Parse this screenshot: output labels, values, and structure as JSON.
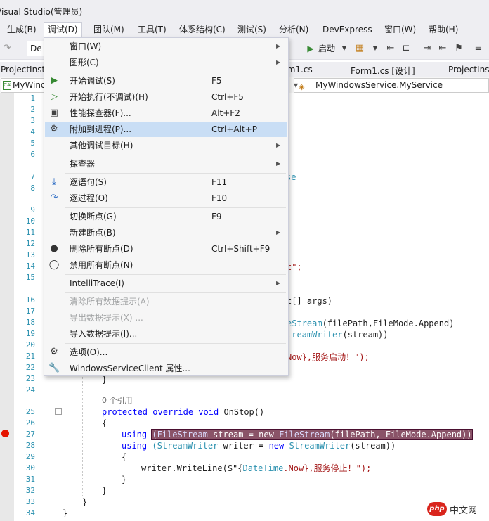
{
  "window": {
    "title": "Visual Studio(管理员)"
  },
  "menubar": {
    "items": [
      "生成(B)",
      "调试(D)",
      "团队(M)",
      "工具(T)",
      "体系结构(C)",
      "测试(S)",
      "分析(N)",
      "DevExpress",
      "窗口(W)",
      "帮助(H)"
    ],
    "active": "调试(D)"
  },
  "toolbar": {
    "config_combo": "De",
    "start_label": "启动"
  },
  "tabs": [
    "ProjectInst",
    "rm1.cs",
    "Form1.cs [设计]",
    "ProjectInst"
  ],
  "navbar": {
    "left": "MyWind",
    "right": "MyWindowsService.MyService"
  },
  "debug_menu": {
    "items": [
      {
        "icon": "",
        "label": "窗口(W)",
        "shortcut": "",
        "submenu": true
      },
      {
        "icon": "",
        "label": "图形(C)",
        "shortcut": "",
        "submenu": true
      },
      {
        "sep": true
      },
      {
        "icon": "start-debug-icon",
        "label": "开始调试(S)",
        "shortcut": "F5"
      },
      {
        "icon": "start-without-debug-icon",
        "label": "开始执行(不调试)(H)",
        "shortcut": "Ctrl+F5"
      },
      {
        "icon": "profiler-icon",
        "label": "性能探查器(F)...",
        "shortcut": "Alt+F2"
      },
      {
        "icon": "attach-process-icon",
        "label": "附加到进程(P)...",
        "shortcut": "Ctrl+Alt+P",
        "hover": true
      },
      {
        "icon": "",
        "label": "其他调试目标(H)",
        "shortcut": "",
        "submenu": true
      },
      {
        "sep": true
      },
      {
        "icon": "",
        "label": "探查器",
        "shortcut": "",
        "submenu": true
      },
      {
        "sep": true
      },
      {
        "icon": "step-into-icon",
        "label": "逐语句(S)",
        "shortcut": "F11"
      },
      {
        "icon": "step-over-icon",
        "label": "逐过程(O)",
        "shortcut": "F10"
      },
      {
        "sep": true
      },
      {
        "icon": "",
        "label": "切换断点(G)",
        "shortcut": "F9"
      },
      {
        "icon": "",
        "label": "新建断点(B)",
        "shortcut": "",
        "submenu": true
      },
      {
        "icon": "delete-breakpoints-icon",
        "label": "删除所有断点(D)",
        "shortcut": "Ctrl+Shift+F9"
      },
      {
        "icon": "disable-breakpoints-icon",
        "label": "禁用所有断点(N)",
        "shortcut": ""
      },
      {
        "sep": true
      },
      {
        "icon": "",
        "label": "IntelliTrace(I)",
        "shortcut": "",
        "submenu": true
      },
      {
        "sep": true
      },
      {
        "icon": "",
        "label": "清除所有数据提示(A)",
        "shortcut": "",
        "disabled": true
      },
      {
        "icon": "",
        "label": "导出数据提示(X) ...",
        "shortcut": "",
        "disabled": true
      },
      {
        "icon": "",
        "label": "导入数据提示(I)...",
        "shortcut": ""
      },
      {
        "sep": true
      },
      {
        "icon": "gear-icon",
        "label": "选项(O)...",
        "shortcut": ""
      },
      {
        "icon": "wrench-icon",
        "label": "WindowsServiceClient 属性...",
        "shortcut": ""
      }
    ]
  },
  "editor": {
    "line_numbers": [
      "1",
      "2",
      "3",
      "4",
      "5",
      "6",
      "7",
      "8",
      "9",
      "10",
      "11",
      "12",
      "13",
      "14",
      "15",
      "16",
      "17",
      "18",
      "19",
      "20",
      "21",
      "22",
      "23",
      "24",
      "25",
      "26",
      "27",
      "28",
      "29",
      "30",
      "31",
      "32",
      "33",
      "34"
    ],
    "fragments": {
      "l7": "se",
      "l14": "t\";",
      "l16": "t[] args)",
      "l18a": "eStream",
      "l18b": "(filePath,FileMode.Append)",
      "l19a": "treamWriter",
      "l19b": "(stream))",
      "l21": "Now},服务启动！\");",
      "l23": "}",
      "ref": "0 个引用",
      "l25": [
        "protected",
        "override",
        "void",
        "OnStop()"
      ],
      "l26": "{",
      "l27": [
        "using",
        "(FileStream",
        "stream",
        "=",
        "new",
        "FileStream",
        "(filePath, FileMode.Append))"
      ],
      "l28": [
        "using",
        "(StreamWriter",
        "writer",
        "=",
        "new",
        "StreamWriter",
        "(stream))"
      ],
      "l29": "{",
      "l30a": "writer.WriteLine($\"{",
      "l30b": "DateTime",
      "l30c": ".Now},服务停止！\");",
      "l31": "}",
      "l32": "}",
      "l33": "}",
      "l34": "}"
    }
  },
  "watermark": {
    "logo": "php",
    "text": "中文网"
  }
}
